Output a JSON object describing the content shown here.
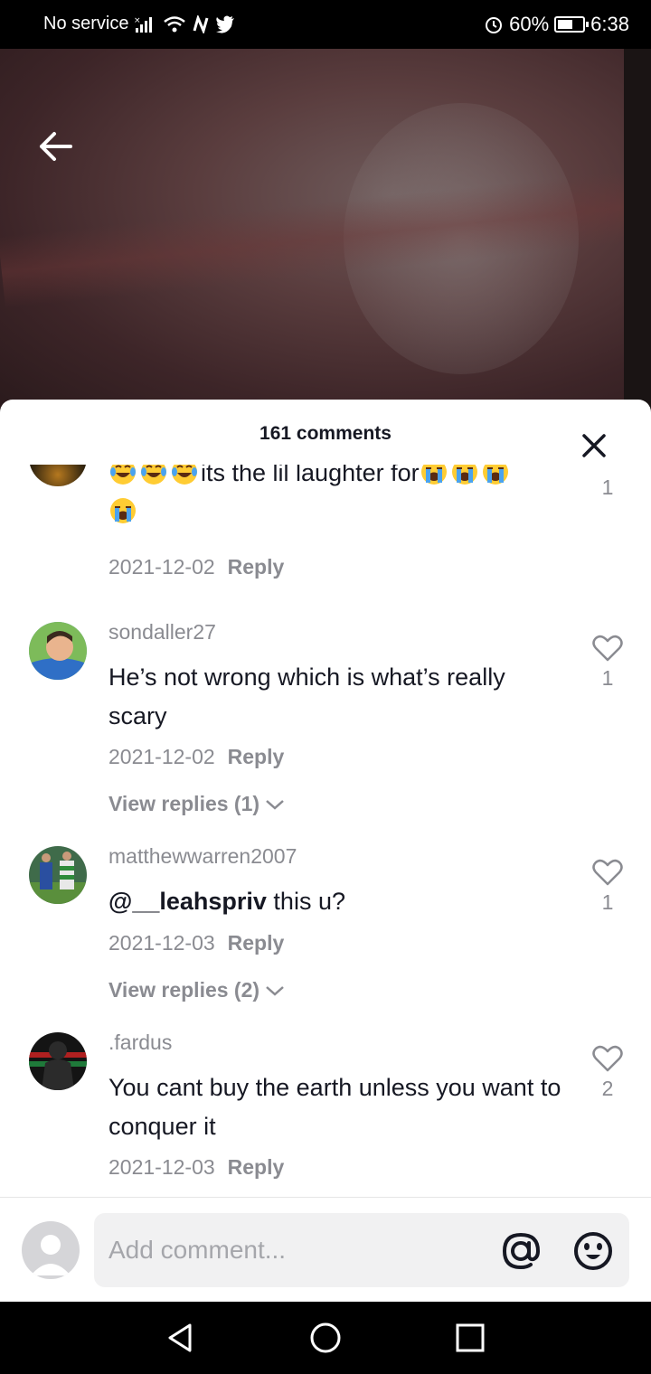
{
  "status_bar": {
    "carrier": "No service",
    "battery": "60%",
    "battery_level": 0.6,
    "time": "6:38"
  },
  "sheet": {
    "title": "161 comments"
  },
  "comments": [
    {
      "username": "",
      "text": "its the lil laughter for",
      "date": "2021-12-02",
      "reply_label": "Reply",
      "likes": "1"
    },
    {
      "username": "sondaller27",
      "text": "He’s not wrong which is what’s really scary",
      "date": "2021-12-02",
      "reply_label": "Reply",
      "likes": "1",
      "view_replies": "View replies (1)"
    },
    {
      "username": "matthewwarren2007",
      "mention": "@__leahspriv",
      "text": " this u?",
      "date": "2021-12-03",
      "reply_label": "Reply",
      "likes": "1",
      "view_replies": "View replies (2)"
    },
    {
      "username": ".fardus",
      "text": "You cant buy the earth unless you want to conquer it",
      "date": "2021-12-03",
      "reply_label": "Reply",
      "likes": "2"
    }
  ],
  "input": {
    "placeholder": "Add comment..."
  },
  "icons": {
    "back": "back-arrow-icon",
    "close": "close-icon",
    "like": "heart-outline-icon",
    "mention": "at-sign-icon",
    "emoji": "smiley-icon"
  }
}
